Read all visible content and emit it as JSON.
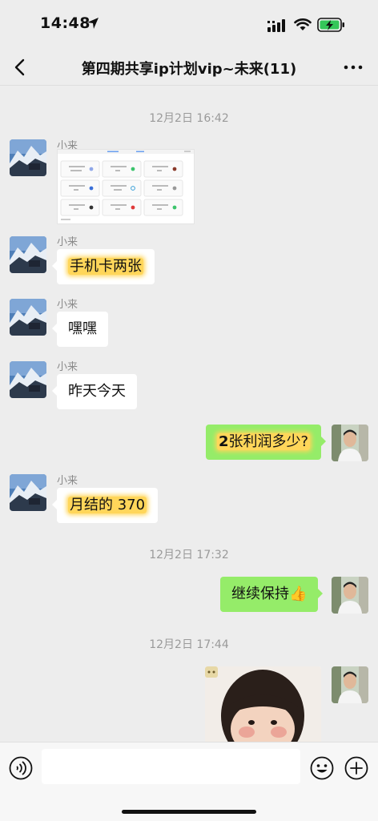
{
  "status": {
    "time": "14:48"
  },
  "nav": {
    "title": "第四期共享ip计划vip~未来(11)"
  },
  "timestamps": [
    "12月2日 16:42",
    "12月2日 17:32",
    "12月2日 17:44"
  ],
  "messages": [
    {
      "sender": "小来",
      "type": "image"
    },
    {
      "sender": "小来",
      "text": "手机卡两张"
    },
    {
      "sender": "小来",
      "text": "嘿嘿"
    },
    {
      "sender": "小来",
      "text": "昨天今天"
    },
    {
      "sender": "me",
      "text_bold": "2",
      "text": "张利润多少?"
    },
    {
      "sender": "小来",
      "text": "月结的 370"
    },
    {
      "sender": "me",
      "text": "继续保持👍"
    },
    {
      "sender": "me",
      "type": "image"
    }
  ],
  "colors": {
    "background": "#ededed",
    "my_bubble": "#95ec69",
    "other_bubble": "#ffffff",
    "highlight": "#ffd65a"
  }
}
